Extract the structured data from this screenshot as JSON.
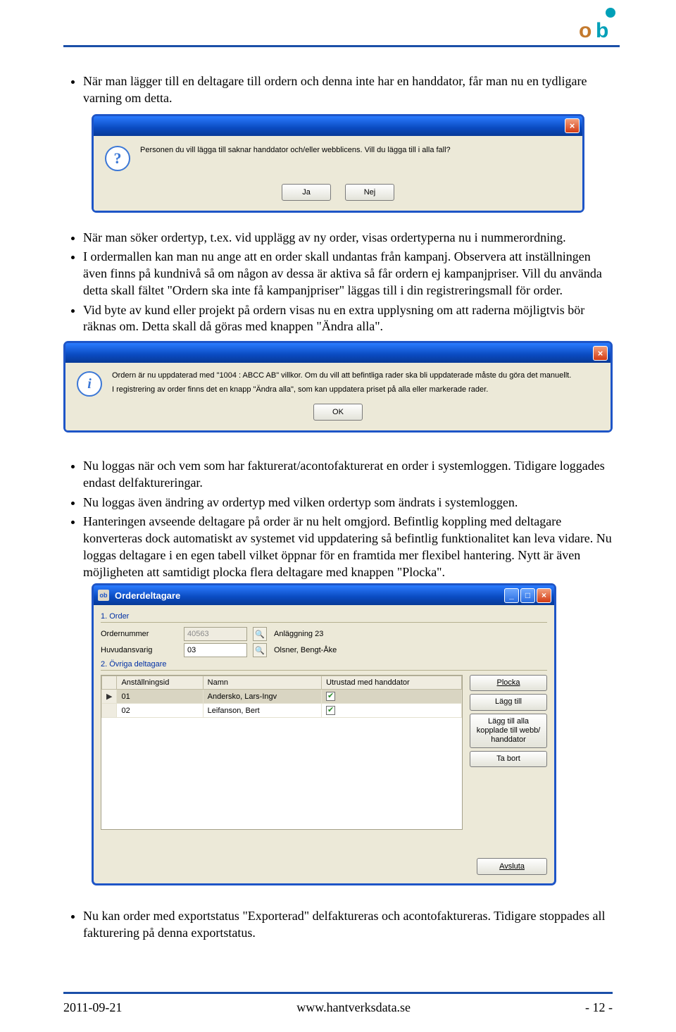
{
  "header": {
    "logo_letters": "ob"
  },
  "bullets_top": [
    "När man lägger till en deltagare till ordern och denna inte har en handdator, får man nu en tydligare varning om detta."
  ],
  "dialog1": {
    "message": "Personen du vill lägga till saknar handdator och/eller webblicens. Vill du lägga till i alla fall?",
    "yes": "Ja",
    "no": "Nej"
  },
  "bullets_mid": [
    "När man söker ordertyp, t.ex. vid upplägg av ny order, visas ordertyperna nu i nummerordning.",
    "I ordermallen kan man nu ange att en order skall undantas från kampanj. Observera att inställningen även finns på kundnivå så om någon av dessa är aktiva så får ordern ej kampanjpriser. Vill du använda detta skall fältet \"Ordern ska inte få kampanjpriser\" läggas till i din registreringsmall för order.",
    "Vid byte av kund eller projekt på ordern visas nu en extra upplysning om att raderna möjligtvis bör räknas om. Detta skall då göras med knappen \"Ändra alla\"."
  ],
  "dialog2": {
    "line1": "Ordern är nu uppdaterad med \"1004 : ABCC AB\" villkor. Om du vill att befintliga rader ska bli uppdaterade måste du göra det manuellt.",
    "line2": "I registrering av order finns det en knapp \"Ändra alla\", som kan uppdatera priset på alla eller markerade rader.",
    "ok": "OK"
  },
  "bullets_after": [
    "Nu loggas när och vem som har fakturerat/acontofakturerat en order i systemloggen. Tidigare loggades endast delfaktureringar.",
    "Nu loggas även ändring av ordertyp med vilken ordertyp som ändrats i systemloggen.",
    "Hanteringen avseende deltagare på order är nu helt omgjord. Befintlig koppling med deltagare konverteras dock automatiskt av systemet vid uppdatering så befintlig funktionalitet kan leva vidare. Nu loggas deltagare i en egen tabell vilket öppnar för en framtida mer flexibel hantering. Nytt är även möjligheten att samtidigt plocka flera deltagare med knappen \"Plocka\"."
  ],
  "appwin": {
    "title": "Orderdeltagare",
    "section1": "1. Order",
    "labels": {
      "orderno": "Ordernummer",
      "orderno_val": "40563",
      "facility": "Anläggning 23",
      "hudansvarig": "Huvudansvarig",
      "hud_val": "03",
      "hud_name": "Olsner, Bengt-Åke"
    },
    "section2": "2. Övriga deltagare",
    "grid": {
      "cols": [
        "Anställningsid",
        "Namn",
        "Utrustad med handdator"
      ],
      "rows": [
        {
          "id": "01",
          "name": "Andersko, Lars-Ingv",
          "hd": true,
          "sel": true
        },
        {
          "id": "02",
          "name": "Leifanson, Bert",
          "hd": true,
          "sel": false
        }
      ]
    },
    "sidebtns": {
      "plocka": "Plocka",
      "lagg": "Lägg till",
      "laggalla": "Lägg till alla kopplade till webb/ handdator",
      "tabort": "Ta bort"
    },
    "avsluta": "Avsluta"
  },
  "bullets_bottom": [
    "Nu kan order med exportstatus \"Exporterad\" delfaktureras och acontofaktureras. Tidigare stoppades all fakturering på denna exportstatus."
  ],
  "footer": {
    "date": "2011-09-21",
    "url": "www.hantverksdata.se",
    "page": "- 12 -"
  }
}
